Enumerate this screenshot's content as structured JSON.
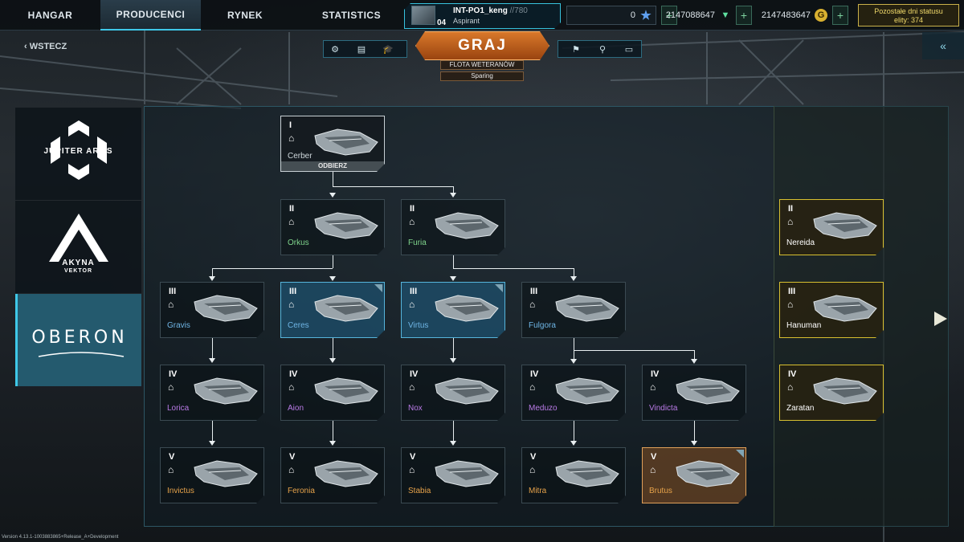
{
  "nav": {
    "tabs": [
      {
        "label": "HANGAR",
        "active": false
      },
      {
        "label": "PRODUCENCI",
        "active": true
      },
      {
        "label": "RYNEK",
        "active": false
      },
      {
        "label": "STATISTICS",
        "active": false
      }
    ]
  },
  "profile": {
    "name": "INT-PO1_keng",
    "name_suffix": "//780",
    "rank": "Aspirant",
    "level": "04"
  },
  "currencies": {
    "stars": "0",
    "credits": "2147088647",
    "gold": "2147483647",
    "gold_icon": "G"
  },
  "elite": {
    "line1": "Pozostałe dni statusu",
    "line2": "elity: 374"
  },
  "toolbar": {
    "back_label": "WSTECZ",
    "play_label": "GRAJ",
    "fleet_label": "FLOTA WETERANÓW",
    "mode_label": "Sparing",
    "icons_left": [
      "gear-icon",
      "document-icon",
      "academy-icon"
    ],
    "icons_right": [
      "flag-icon",
      "add-friend-icon",
      "chat-icon"
    ]
  },
  "manufacturers": [
    {
      "name": "JUPITER ARMS",
      "active": false
    },
    {
      "name": "AKYNA",
      "sub": "VEKTOR",
      "active": false
    },
    {
      "name": "OBERON",
      "active": true
    }
  ],
  "ships": [
    {
      "id": "cerber",
      "tier": "I",
      "name": "Cerber",
      "color": "#cfd8dc",
      "state": "tier1",
      "action": "ODBIERZ"
    },
    {
      "id": "orkus",
      "tier": "II",
      "name": "Orkus",
      "color": "#7fd48c",
      "state": "normal"
    },
    {
      "id": "furia",
      "tier": "II",
      "name": "Furia",
      "color": "#7fd48c",
      "state": "normal"
    },
    {
      "id": "gravis",
      "tier": "III",
      "name": "Gravis",
      "color": "#6fb6e6",
      "state": "normal"
    },
    {
      "id": "ceres",
      "tier": "III",
      "name": "Ceres",
      "color": "#6fb6e6",
      "state": "selected"
    },
    {
      "id": "virtus",
      "tier": "III",
      "name": "Virtus",
      "color": "#6fb6e6",
      "state": "selected"
    },
    {
      "id": "fulgora",
      "tier": "III",
      "name": "Fulgora",
      "color": "#6fb6e6",
      "state": "normal"
    },
    {
      "id": "lorica",
      "tier": "IV",
      "name": "Lorica",
      "color": "#b97ae6",
      "state": "normal"
    },
    {
      "id": "aion",
      "tier": "IV",
      "name": "Aion",
      "color": "#b97ae6",
      "state": "normal"
    },
    {
      "id": "nox",
      "tier": "IV",
      "name": "Nox",
      "color": "#b97ae6",
      "state": "normal"
    },
    {
      "id": "meduzo",
      "tier": "IV",
      "name": "Meduzo",
      "color": "#b97ae6",
      "state": "normal"
    },
    {
      "id": "vindicta",
      "tier": "IV",
      "name": "Vindicta",
      "color": "#b97ae6",
      "state": "normal"
    },
    {
      "id": "invictus",
      "tier": "V",
      "name": "Invictus",
      "color": "#e6a24a",
      "state": "normal"
    },
    {
      "id": "feronia",
      "tier": "V",
      "name": "Feronia",
      "color": "#e6a24a",
      "state": "normal"
    },
    {
      "id": "stabia",
      "tier": "V",
      "name": "Stabia",
      "color": "#e6a24a",
      "state": "normal"
    },
    {
      "id": "mitra",
      "tier": "V",
      "name": "Mitra",
      "color": "#e6a24a",
      "state": "normal"
    },
    {
      "id": "brutus",
      "tier": "V",
      "name": "Brutus",
      "color": "#e6a24a",
      "state": "orange"
    }
  ],
  "premium_ships": [
    {
      "id": "nereida",
      "tier": "II",
      "name": "Nereida",
      "color": "#ffffff"
    },
    {
      "id": "hanuman",
      "tier": "III",
      "name": "Hanuman",
      "color": "#ffffff"
    },
    {
      "id": "zaratan",
      "tier": "IV",
      "name": "Zaratan",
      "color": "#ffffff"
    }
  ],
  "version": "Version 4.13.1-1003883865+Release_A+Development"
}
